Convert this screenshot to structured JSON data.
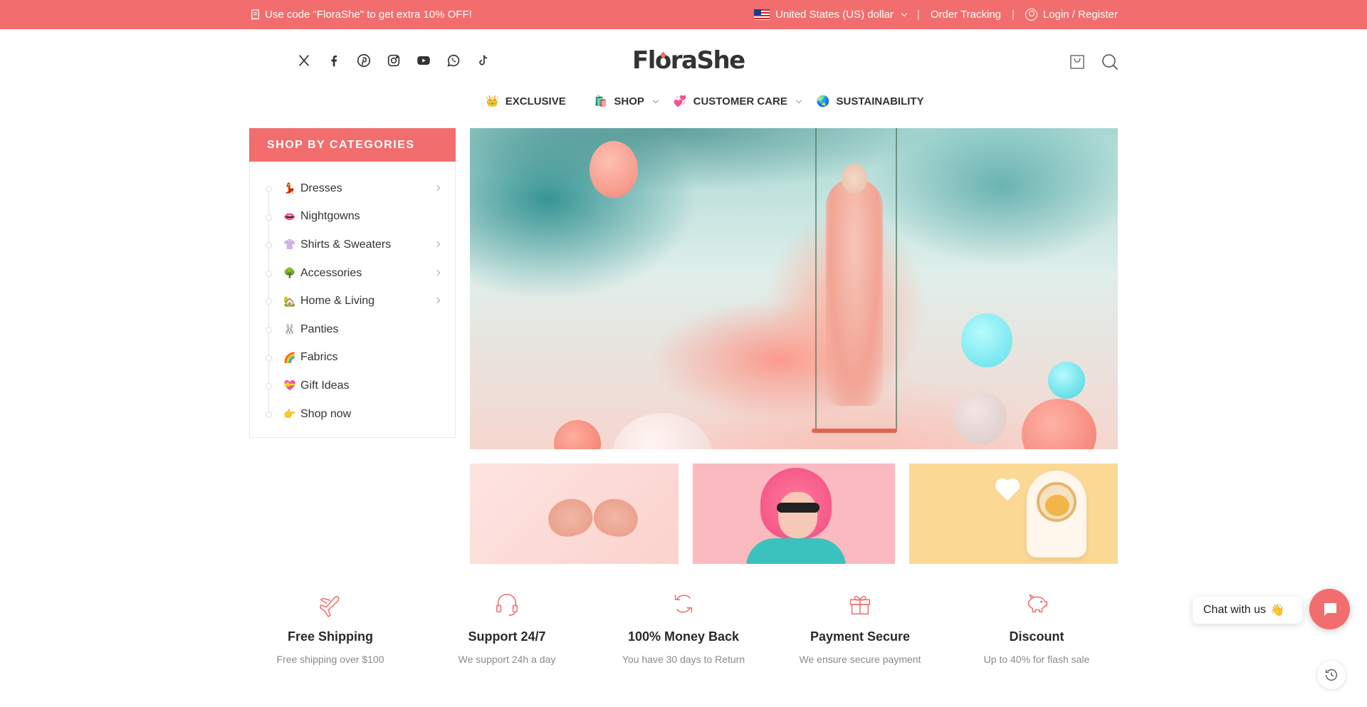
{
  "topbar": {
    "promo": "Use code \"FloraShe\" to get extra 10% OFF!",
    "currency": "United States (US) dollar",
    "order_tracking": "Order Tracking",
    "login": "Login / Register"
  },
  "header": {
    "logo": "FloraShe",
    "socials": [
      "x-icon",
      "facebook-icon",
      "pinterest-icon",
      "instagram-icon",
      "youtube-icon",
      "whatsapp-icon",
      "tiktok-icon"
    ]
  },
  "nav": [
    {
      "emoji": "👑",
      "label": "EXCLUSIVE",
      "dropdown": false
    },
    {
      "emoji": "🛍️",
      "label": "SHOP",
      "dropdown": true
    },
    {
      "emoji": "💞",
      "label": "CUSTOMER CARE",
      "dropdown": true
    },
    {
      "emoji": "🌏",
      "label": "SUSTAINABILITY",
      "dropdown": false
    }
  ],
  "categories": {
    "title": "SHOP BY CATEGORIES",
    "items": [
      {
        "emoji": "💃",
        "label": "Dresses",
        "has_sub": true
      },
      {
        "emoji": "👄",
        "label": "Nightgowns",
        "has_sub": false
      },
      {
        "emoji": "👚",
        "label": "Shirts & Sweaters",
        "has_sub": true
      },
      {
        "emoji": "🌳",
        "label": "Accessories",
        "has_sub": true
      },
      {
        "emoji": "🏡",
        "label": "Home & Living",
        "has_sub": true
      },
      {
        "emoji": "🐰",
        "label": "Panties",
        "has_sub": false
      },
      {
        "emoji": "🌈",
        "label": "Fabrics",
        "has_sub": false
      },
      {
        "emoji": "💝",
        "label": "Gift Ideas",
        "has_sub": false
      },
      {
        "emoji": "👉",
        "label": "Shop now",
        "has_sub": false
      }
    ]
  },
  "features": [
    {
      "icon": "airplane-icon",
      "title": "Free Shipping",
      "sub": "Free shipping over $100"
    },
    {
      "icon": "headset-icon",
      "title": "Support 24/7",
      "sub": "We support 24h a day"
    },
    {
      "icon": "refresh-icon",
      "title": "100% Money Back",
      "sub": "You have 30 days to Return"
    },
    {
      "icon": "gift-icon",
      "title": "Payment Secure",
      "sub": "We ensure secure payment"
    },
    {
      "icon": "piggy-bank-icon",
      "title": "Discount",
      "sub": "Up to 40% for flash sale"
    }
  ],
  "chat": {
    "label": "Chat with us",
    "emoji": "👋"
  },
  "colors": {
    "accent": "#f26d6d"
  }
}
